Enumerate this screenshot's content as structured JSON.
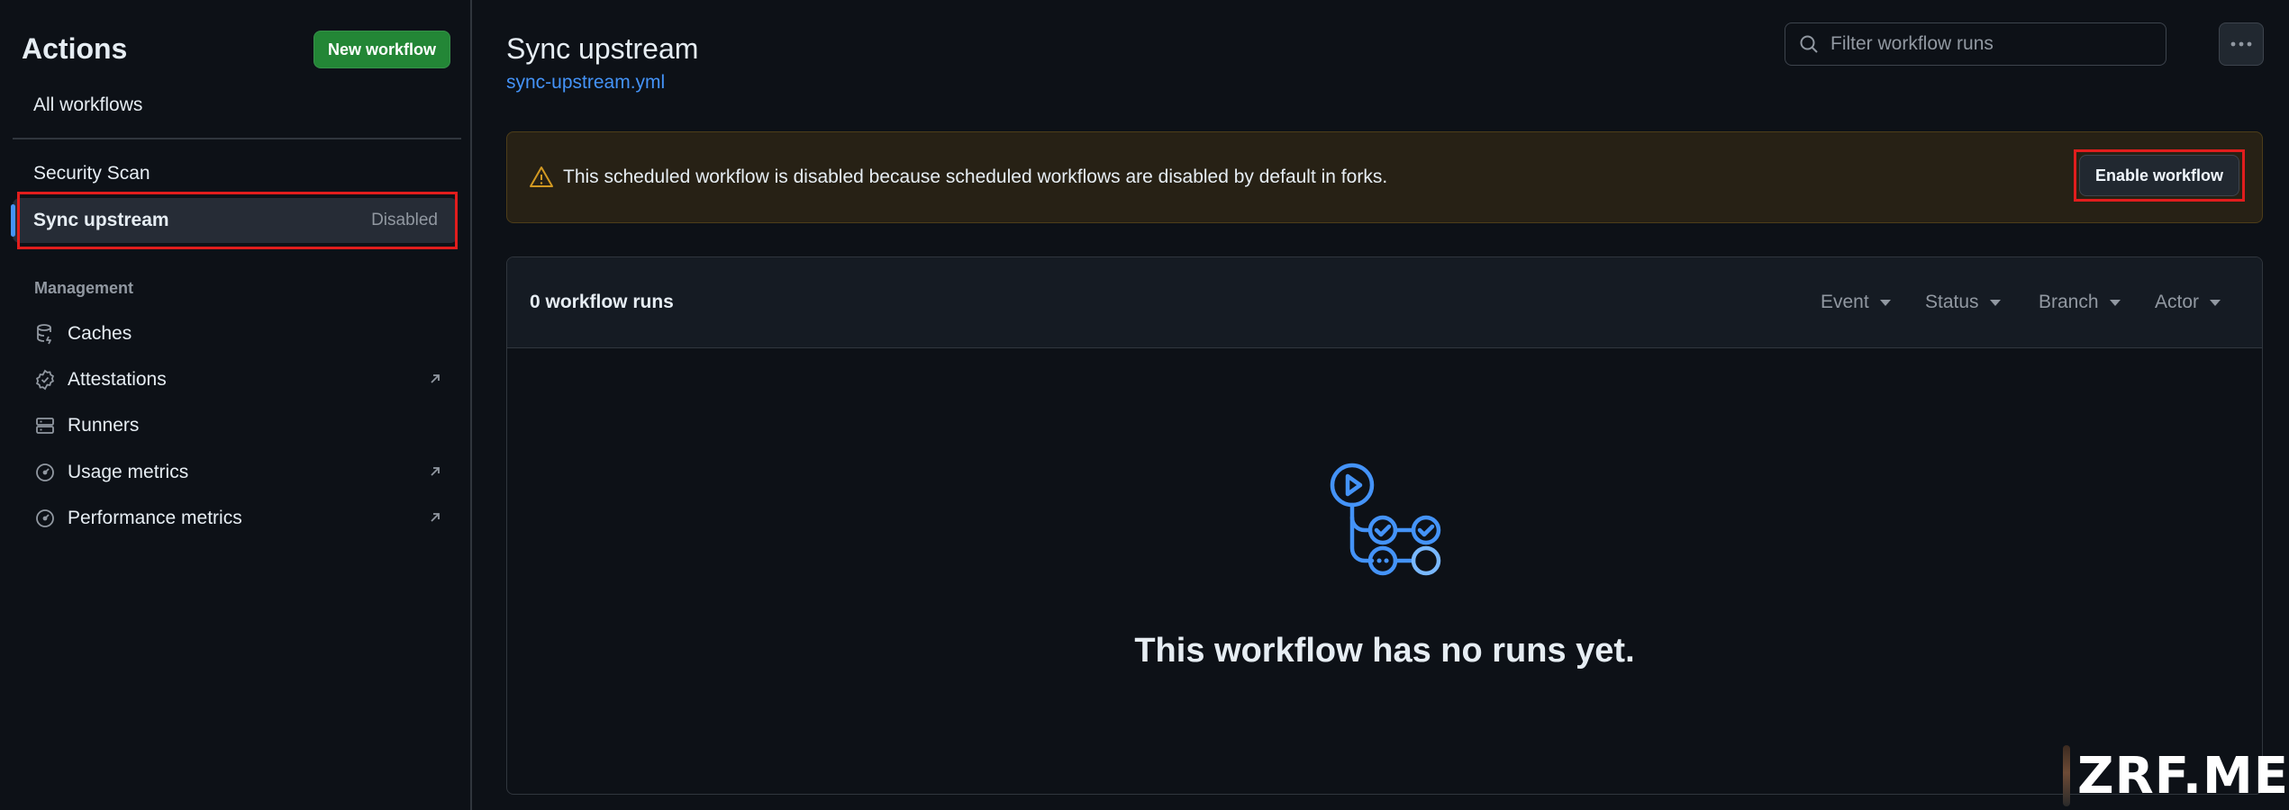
{
  "sidebar": {
    "title": "Actions",
    "new_workflow_label": "New workflow",
    "all_workflows": "All workflows",
    "workflows": [
      {
        "label": "Security Scan"
      },
      {
        "label": "Sync upstream",
        "status": "Disabled",
        "active": true
      }
    ],
    "management_heading": "Management",
    "management": [
      {
        "label": "Caches",
        "icon": "database-icon",
        "external": false
      },
      {
        "label": "Attestations",
        "icon": "verified-icon",
        "external": true
      },
      {
        "label": "Runners",
        "icon": "server-icon",
        "external": false
      },
      {
        "label": "Usage metrics",
        "icon": "meter-icon",
        "external": true
      },
      {
        "label": "Performance metrics",
        "icon": "meter-icon",
        "external": true
      }
    ]
  },
  "header": {
    "title": "Sync upstream",
    "workflow_file": "sync-upstream.yml",
    "search_placeholder": "Filter workflow runs"
  },
  "banner": {
    "message": "This scheduled workflow is disabled because scheduled workflows are disabled by default in forks.",
    "enable_label": "Enable workflow"
  },
  "runs": {
    "count_label": "0 workflow runs",
    "filters": [
      "Event",
      "Status",
      "Branch",
      "Actor"
    ],
    "empty_message": "This workflow has no runs yet."
  },
  "watermark": {
    "text": "ZRF.ME"
  },
  "colors": {
    "background": "#0d1117",
    "primary_button": "#238636",
    "link": "#4493f8",
    "warning": "#d29922",
    "highlight_box": "#e11d1d"
  }
}
